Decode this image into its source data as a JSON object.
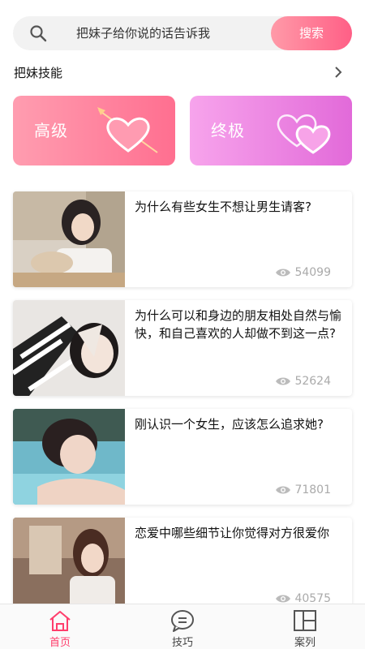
{
  "search": {
    "text": "把妹子给你说的话告诉我",
    "button_label": "搜索"
  },
  "skills": {
    "title": "把妹技能",
    "cards": [
      {
        "label": "高级"
      },
      {
        "label": "终极"
      }
    ]
  },
  "articles": [
    {
      "title": "为什么有些女生不想让男生请客?",
      "views": "54099"
    },
    {
      "title": "为什么可以和身边的朋友相处自然与愉快，和自己喜欢的人却做不到这一点?",
      "views": "52624"
    },
    {
      "title": "刚认识一个女生，应该怎么追求她?",
      "views": "71801"
    },
    {
      "title": "恋爱中哪些细节让你觉得对方很爱你",
      "views": "40575"
    }
  ],
  "nav": {
    "items": [
      {
        "label": "首页",
        "icon": "home-icon"
      },
      {
        "label": "技巧",
        "icon": "chat-icon"
      },
      {
        "label": "案列",
        "icon": "grid-icon"
      }
    ]
  },
  "colors": {
    "accent": "#ff5f86",
    "active_nav": "#ff3e6c",
    "advanced_card": "#ff6f90",
    "ultimate_card": "#e26ad9"
  }
}
